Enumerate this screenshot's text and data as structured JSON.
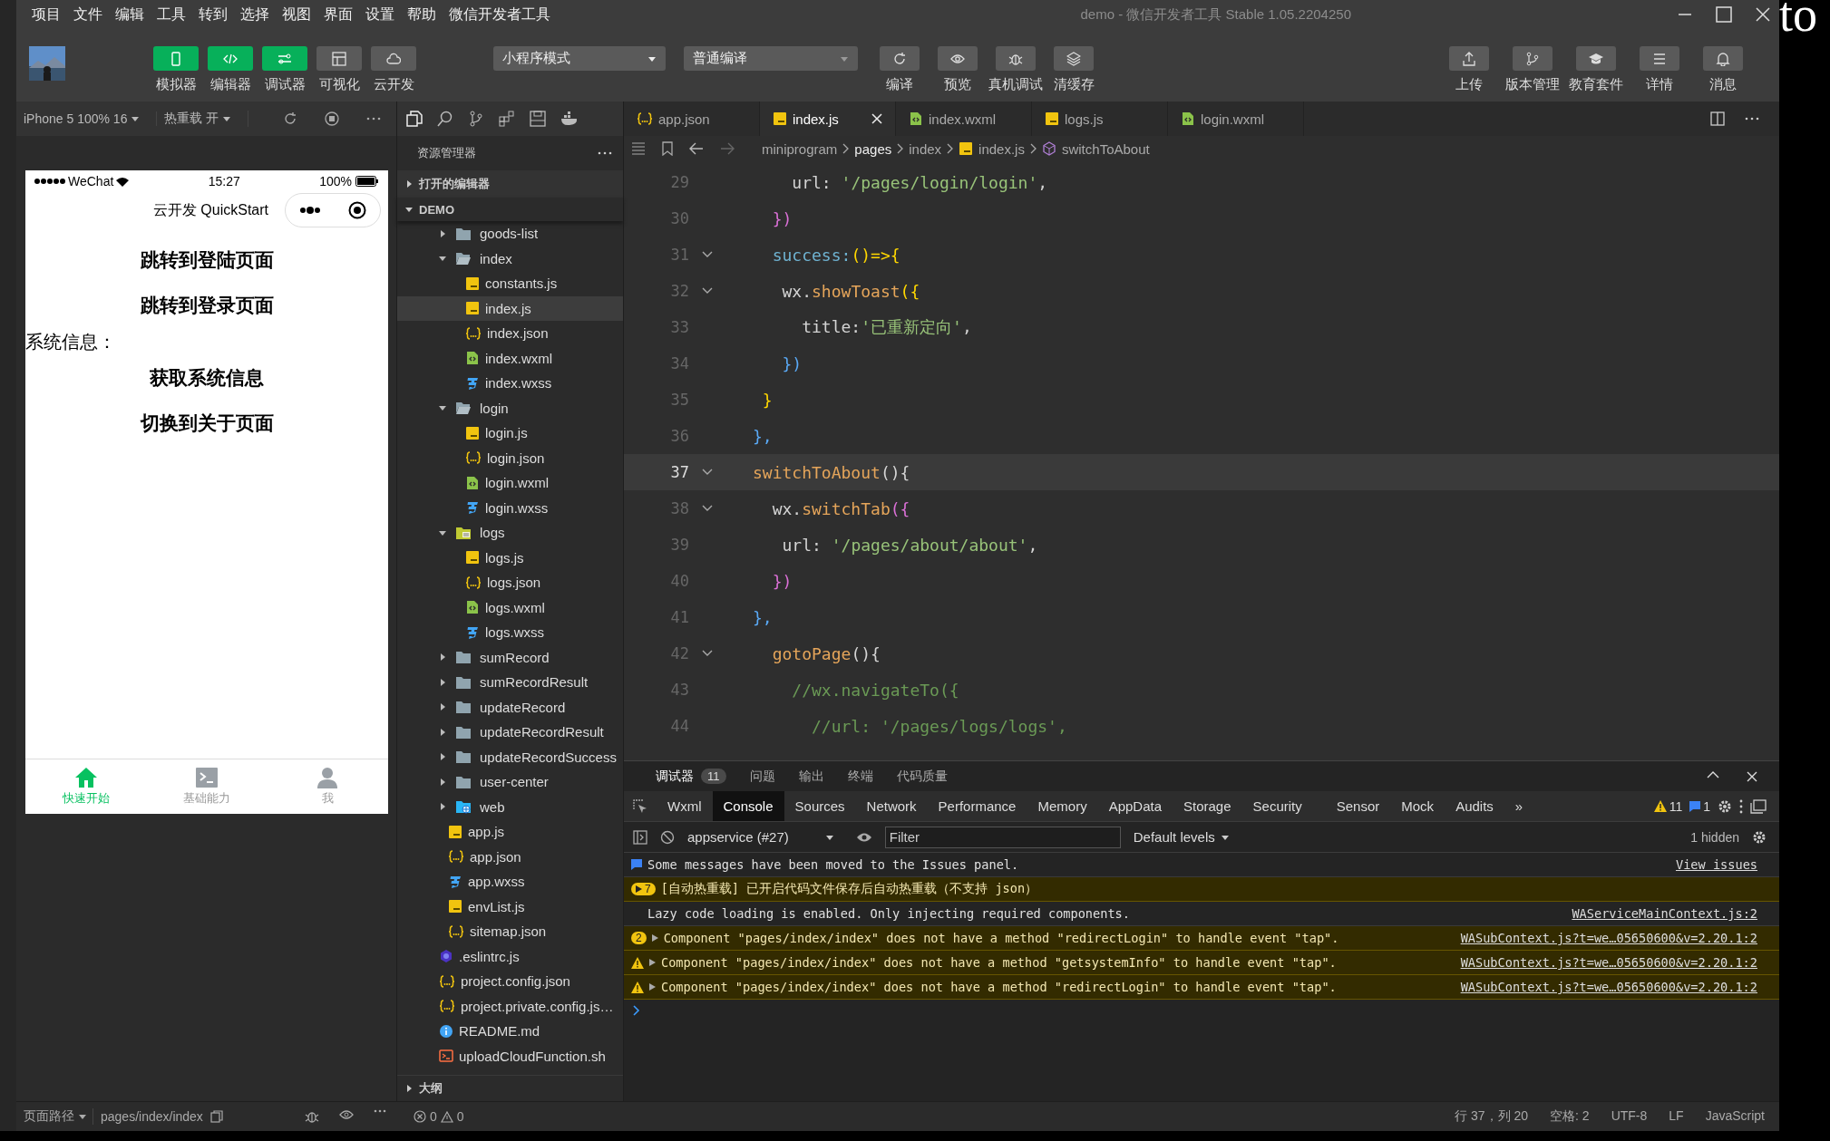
{
  "menu_bar": {
    "items": [
      "项目",
      "文件",
      "编辑",
      "工具",
      "转到",
      "选择",
      "视图",
      "界面",
      "设置",
      "帮助",
      "微信开发者工具"
    ],
    "title": "demo - 微信开发者工具 Stable 1.05.2204250"
  },
  "background_window": {
    "text": "to"
  },
  "toolbar": {
    "view_toggles": [
      {
        "label": "模拟器",
        "on": true
      },
      {
        "label": "编辑器",
        "on": true
      },
      {
        "label": "调试器",
        "on": true
      },
      {
        "label": "可视化",
        "on": false
      },
      {
        "label": "云开发",
        "on": false
      }
    ],
    "mode_select": "小程序模式",
    "compile_select": "普通编译",
    "actions": [
      "编译",
      "预览",
      "真机调试",
      "清缓存"
    ],
    "right_actions": [
      "上传",
      "版本管理",
      "教育套件",
      "详情",
      "消息"
    ]
  },
  "simulator": {
    "device": "iPhone 5 100% 16",
    "hot_reload": "热重载 开",
    "phone": {
      "carrier": "WeChat",
      "time": "15:27",
      "battery": "100%",
      "nav_title": "云开发 QuickStart",
      "content": [
        {
          "text": "跳转到登陆页面",
          "kind": "button"
        },
        {
          "text": "跳转到登录页面",
          "kind": "button"
        },
        {
          "text": "系统信息：",
          "kind": "label"
        },
        {
          "text": "获取系统信息",
          "kind": "button"
        },
        {
          "text": "切换到关于页面",
          "kind": "button"
        }
      ],
      "tabs": [
        {
          "label": "快速开始",
          "selected": true
        },
        {
          "label": "基础能力",
          "selected": false
        },
        {
          "label": "我",
          "selected": false
        }
      ]
    }
  },
  "explorer": {
    "title": "资源管理器",
    "sections": [
      {
        "label": "打开的编辑器",
        "expanded": false
      },
      {
        "label": "DEMO",
        "expanded": true
      }
    ],
    "groups": [
      {
        "kind": "deep",
        "items": [
          {
            "label": "goods-list",
            "kind": "folder",
            "expanded": false,
            "selected": false
          },
          {
            "label": "index",
            "kind": "folder",
            "expanded": true,
            "selected": false,
            "children": [
              {
                "label": "constants.js",
                "kind": "js",
                "selected": false
              },
              {
                "label": "index.js",
                "kind": "js",
                "selected": true
              },
              {
                "label": "index.json",
                "kind": "json",
                "selected": false
              },
              {
                "label": "index.wxml",
                "kind": "wxml",
                "selected": false
              },
              {
                "label": "index.wxss",
                "kind": "wxss",
                "selected": false
              }
            ]
          },
          {
            "label": "login",
            "kind": "folder",
            "expanded": true,
            "selected": false,
            "children": [
              {
                "label": "login.js",
                "kind": "js",
                "selected": false
              },
              {
                "label": "login.json",
                "kind": "json",
                "selected": false
              },
              {
                "label": "login.wxml",
                "kind": "wxml",
                "selected": false
              },
              {
                "label": "login.wxss",
                "kind": "wxss",
                "selected": false
              }
            ]
          },
          {
            "label": "logs",
            "kind": "logs",
            "expanded": true,
            "selected": false,
            "children": [
              {
                "label": "logs.js",
                "kind": "js",
                "selected": false
              },
              {
                "label": "logs.json",
                "kind": "json",
                "selected": false
              },
              {
                "label": "logs.wxml",
                "kind": "wxml",
                "selected": false
              },
              {
                "label": "logs.wxss",
                "kind": "wxss",
                "selected": false
              }
            ]
          },
          {
            "label": "sumRecord",
            "kind": "folder",
            "expanded": false,
            "selected": false
          },
          {
            "label": "sumRecordResult",
            "kind": "folder",
            "expanded": false,
            "selected": false
          },
          {
            "label": "updateRecord",
            "kind": "folder",
            "expanded": false,
            "selected": false
          },
          {
            "label": "updateRecordResult",
            "kind": "folder",
            "expanded": false,
            "selected": false
          },
          {
            "label": "updateRecordSuccess",
            "kind": "folder",
            "expanded": false,
            "selected": false
          },
          {
            "label": "user-center",
            "kind": "folder",
            "expanded": false,
            "selected": false
          },
          {
            "label": "web",
            "kind": "web",
            "expanded": false,
            "selected": false
          }
        ]
      },
      {
        "kind": "mid",
        "items": [
          {
            "label": "app.js",
            "kind": "js",
            "selected": false
          },
          {
            "label": "app.json",
            "kind": "json",
            "selected": false
          },
          {
            "label": "app.wxss",
            "kind": "wxss",
            "selected": false
          },
          {
            "label": "envList.js",
            "kind": "js",
            "selected": false
          },
          {
            "label": "sitemap.json",
            "kind": "json",
            "selected": false
          }
        ]
      },
      {
        "kind": "top",
        "items": [
          {
            "label": ".eslintrc.js",
            "kind": "eslint",
            "selected": false
          },
          {
            "label": "project.config.json",
            "kind": "json",
            "selected": false
          },
          {
            "label": "project.private.config.js…",
            "kind": "json",
            "selected": false
          },
          {
            "label": "README.md",
            "kind": "md",
            "selected": false
          },
          {
            "label": "uploadCloudFunction.sh",
            "kind": "sh",
            "selected": false
          }
        ]
      }
    ],
    "outline": {
      "label": "大纲",
      "expanded": false
    }
  },
  "editor": {
    "tabs": [
      {
        "label": "app.json",
        "kind": "json",
        "selected": false
      },
      {
        "label": "index.js",
        "kind": "js",
        "selected": true
      },
      {
        "label": "index.wxml",
        "kind": "wxml",
        "selected": false
      },
      {
        "label": "logs.js",
        "kind": "js",
        "selected": false
      },
      {
        "label": "login.wxml",
        "kind": "wxml",
        "selected": false
      }
    ],
    "breadcrumb": [
      {
        "label": "miniprogram",
        "kind": "folder"
      },
      {
        "label": "pages",
        "kind": "folder"
      },
      {
        "label": "index",
        "kind": "folder"
      },
      {
        "label": "index.js",
        "kind": "js"
      },
      {
        "label": "switchToAbout",
        "kind": "method"
      }
    ],
    "lines": [
      {
        "number": "29",
        "fold": false,
        "current": false,
        "tokens": [
          {
            "text": "    url: ",
            "kind": "plain"
          },
          {
            "text": "'/pages/login/login'",
            "kind": "string"
          },
          {
            "text": ",",
            "kind": "plain"
          }
        ]
      },
      {
        "number": "30",
        "fold": false,
        "current": false,
        "tokens": [
          {
            "text": "  })",
            "kind": "brace2"
          }
        ]
      },
      {
        "number": "31",
        "fold": true,
        "current": false,
        "tokens": [
          {
            "text": "  success:",
            "kind": "prop"
          },
          {
            "text": "()=>{",
            "kind": "brace1"
          }
        ]
      },
      {
        "number": "32",
        "fold": true,
        "current": false,
        "tokens": [
          {
            "text": "   wx.",
            "kind": "plain"
          },
          {
            "text": "showToast",
            "kind": "func"
          },
          {
            "text": "({",
            "kind": "brace1"
          }
        ]
      },
      {
        "number": "33",
        "fold": false,
        "current": false,
        "tokens": [
          {
            "text": "     title:",
            "kind": "plain"
          },
          {
            "text": "'已重新定向'",
            "kind": "string"
          },
          {
            "text": ",",
            "kind": "plain"
          }
        ]
      },
      {
        "number": "34",
        "fold": false,
        "current": false,
        "tokens": [
          {
            "text": "   })",
            "kind": "brace3"
          }
        ]
      },
      {
        "number": "35",
        "fold": false,
        "current": false,
        "tokens": [
          {
            "text": " }",
            "kind": "brace1"
          }
        ]
      },
      {
        "number": "36",
        "fold": false,
        "current": false,
        "tokens": [
          {
            "text": "},",
            "kind": "brace3"
          }
        ]
      },
      {
        "number": "37",
        "fold": true,
        "current": true,
        "tokens": [
          {
            "text": "switchToAbout",
            "kind": "func"
          },
          {
            "text": "(){",
            "kind": "plain"
          }
        ]
      },
      {
        "number": "38",
        "fold": true,
        "current": false,
        "tokens": [
          {
            "text": "  wx.",
            "kind": "plain"
          },
          {
            "text": "switchTab",
            "kind": "func"
          },
          {
            "text": "({",
            "kind": "brace2"
          }
        ]
      },
      {
        "number": "39",
        "fold": false,
        "current": false,
        "tokens": [
          {
            "text": "   url: ",
            "kind": "plain"
          },
          {
            "text": "'/pages/about/about'",
            "kind": "string"
          },
          {
            "text": ",",
            "kind": "plain"
          }
        ]
      },
      {
        "number": "40",
        "fold": false,
        "current": false,
        "tokens": [
          {
            "text": "  })",
            "kind": "brace2"
          }
        ]
      },
      {
        "number": "41",
        "fold": false,
        "current": false,
        "tokens": [
          {
            "text": "},",
            "kind": "brace3"
          }
        ]
      },
      {
        "number": "42",
        "fold": true,
        "current": false,
        "tokens": [
          {
            "text": "  gotoPage",
            "kind": "func"
          },
          {
            "text": "(){",
            "kind": "plain"
          }
        ]
      },
      {
        "number": "43",
        "fold": false,
        "current": false,
        "tokens": [
          {
            "text": "    //wx.navigateTo({",
            "kind": "comment"
          }
        ]
      },
      {
        "number": "44",
        "fold": false,
        "current": false,
        "tokens": [
          {
            "text": "      //url: '/pages/logs/logs',",
            "kind": "comment"
          }
        ]
      }
    ]
  },
  "console": {
    "panel_tabs": [
      {
        "label": "调试器",
        "badge": "11",
        "selected": true
      },
      {
        "label": "问题",
        "selected": false
      },
      {
        "label": "输出",
        "selected": false
      },
      {
        "label": "终端",
        "selected": false
      },
      {
        "label": "代码质量",
        "selected": false
      }
    ],
    "devtools_tabs": [
      {
        "label": "Wxml",
        "selected": false
      },
      {
        "label": "Console",
        "selected": true
      },
      {
        "label": "Sources",
        "selected": false
      },
      {
        "label": "Network",
        "selected": false
      },
      {
        "label": "Performance",
        "selected": false
      },
      {
        "label": "Memory",
        "selected": false
      },
      {
        "label": "AppData",
        "selected": false
      },
      {
        "label": "Storage",
        "selected": false
      },
      {
        "label": "Security",
        "selected": false
      },
      {
        "label": "Sensor",
        "selected": false
      },
      {
        "label": "Mock",
        "selected": false
      },
      {
        "label": "Audits",
        "selected": false
      }
    ],
    "more": "»",
    "warning_count": "11",
    "message_count": "1",
    "context": "appservice (#27)",
    "filter_placeholder": "Filter",
    "levels": "Default levels",
    "hidden": "1 hidden",
    "messages": [
      {
        "kind": "info",
        "text": "Some messages have been moved to the Issues panel.",
        "link": "View issues"
      },
      {
        "kind": "group",
        "count": "7",
        "text": "[自动热重载] 已开启代码文件保存后自动热重载（不支持 json）"
      },
      {
        "kind": "log",
        "text": "Lazy code loading is enabled. Only injecting required components.",
        "link": "WAServiceMainContext.js:2"
      },
      {
        "kind": "warn",
        "count": "2",
        "text": "Component \"pages/index/index\" does not have a method \"redirectLogin\" to handle event \"tap\".",
        "link": "WASubContext.js?t=we…05650600&v=2.20.1:2"
      },
      {
        "kind": "warn",
        "text": "Component \"pages/index/index\" does not have a method \"getsystemInfo\" to handle event \"tap\".",
        "link": "WASubContext.js?t=we…05650600&v=2.20.1:2"
      },
      {
        "kind": "warn",
        "text": "Component \"pages/index/index\" does not have a method \"redirectLogin\" to handle event \"tap\".",
        "link": "WASubContext.js?t=we…05650600&v=2.20.1:2"
      }
    ]
  },
  "status_bar": {
    "page_path_label": "页面路径",
    "page_path": "pages/index/index",
    "errors": "0",
    "warnings": "0",
    "position": "行 37，列 20",
    "indent": "空格: 2",
    "encoding": "UTF-8",
    "eol": "LF",
    "language": "JavaScript"
  }
}
